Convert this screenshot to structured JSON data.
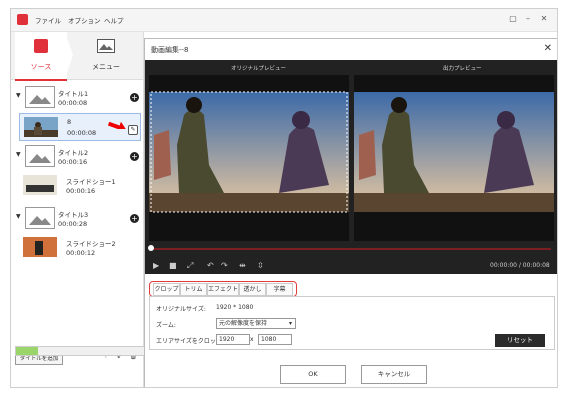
{
  "menus": [
    "ファイル",
    "オプション",
    "ヘルプ"
  ],
  "left": {
    "tabs": {
      "source": "ソース",
      "menu": "メニュー"
    },
    "groups": [
      {
        "title": "タイトル1",
        "time": "00:00:08"
      },
      {
        "title": "タイトル2",
        "time": "00:00:16"
      },
      {
        "title": "タイトル3",
        "time": "00:00:28"
      }
    ],
    "clips": [
      {
        "title": "8",
        "time": "00:00:08"
      },
      {
        "title": "スライドショー1",
        "time": "00:00:16"
      },
      {
        "title": "スライドショー2",
        "time": "00:00:12"
      }
    ],
    "add_title": "タイトルを追加",
    "progress": 0.08
  },
  "dialog": {
    "title": "動画編集--8",
    "original_preview": "オリジナルプレビュー",
    "output_preview": "出力プレビュー",
    "time": "00:00:00 / 00:00:08",
    "tabs": [
      "クロップ",
      "トリム",
      "エフェクト",
      "透かし",
      "字幕"
    ],
    "orig_size_label": "オリジナルサイズ:",
    "orig_size": "1920 * 1080",
    "zoom_label": "ズーム:",
    "zoom_value": "元の解像度を保持",
    "crop_label": "エリアサイズをクロップ:",
    "crop_w": "1920",
    "crop_h": "1080",
    "x": "x",
    "reset": "リセット",
    "ok": "OK",
    "cancel": "キャンセル"
  }
}
